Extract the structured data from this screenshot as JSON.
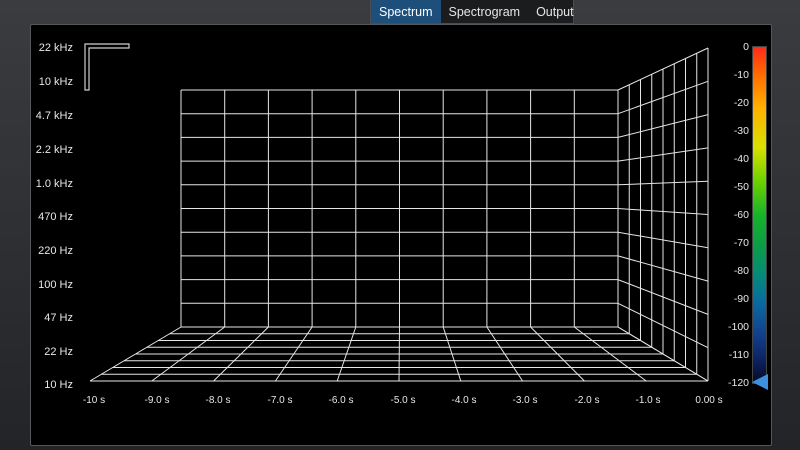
{
  "tabs": [
    {
      "label": "Spectrum",
      "active": true
    },
    {
      "label": "Spectrogram",
      "active": false
    },
    {
      "label": "Output",
      "active": false
    }
  ],
  "y_axis": {
    "labels": [
      "22 kHz",
      "10 kHz",
      "4.7 kHz",
      "2.2 kHz",
      "1.0 kHz",
      "470 Hz",
      "220 Hz",
      "100 Hz",
      "47 Hz",
      "22 Hz",
      "10 Hz"
    ]
  },
  "x_axis": {
    "labels": [
      "-10 s",
      "-9.0 s",
      "-8.0 s",
      "-7.0 s",
      "-6.0 s",
      "-5.0 s",
      "-4.0 s",
      "-3.0 s",
      "-2.0 s",
      "-1.0 s",
      "0.00 s"
    ]
  },
  "colorbar": {
    "labels": [
      "0",
      "-10",
      "-20",
      "-30",
      "-40",
      "-50",
      "-60",
      "-70",
      "-80",
      "-90",
      "-100",
      "-110",
      "-120"
    ],
    "pointer_value": -120
  },
  "colors": {
    "accent": "#1d4f7a",
    "grid": "#e6e6e6",
    "background": "#000000"
  }
}
